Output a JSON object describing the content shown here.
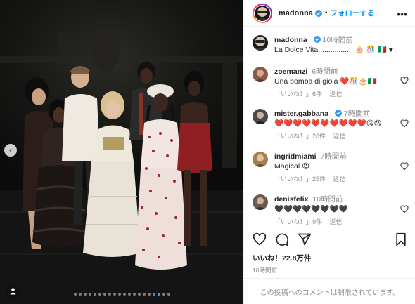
{
  "post": {
    "author": "madonna",
    "follow_label": "フォローする",
    "caption": {
      "username": "madonna",
      "time": "10時間前",
      "text": "La Dolce Vita.................",
      "emoji": "🎂 🎊 🇮🇹 ♥"
    },
    "likes_text": "いいね！22.8万件",
    "posted_time": "10時間前",
    "comments_closed": "この投稿へのコメントは制限されています。"
  },
  "comments": [
    {
      "username": "zoemanzi",
      "time": "6時間前",
      "text": "Una bomba di gioia ❤️🎊🎂🇮🇹",
      "likes": "「いいね！」6件",
      "reply": "返信",
      "avatar_color": "#8a5a4e"
    },
    {
      "username": "mister.gabbana",
      "time": "7時間前",
      "text": "❤️❤️❤️❤️❤️❤️❤️❤️❤️❤️😘😘",
      "likes": "「いいね！」28件",
      "reply": "返信",
      "avatar_color": "#4a4a4a"
    },
    {
      "username": "ingridmiami",
      "time": "7時間前",
      "text": "Magical 😍",
      "likes": "「いいね！」25件",
      "reply": "返信",
      "avatar_color": "#a7804f"
    },
    {
      "username": "denisfelix",
      "time": "10時間前",
      "text": "🖤🖤🖤🖤🖤🖤🖤🖤",
      "likes": "「いいね！」9件",
      "reply": "返信",
      "avatar_color": "#6b5a50"
    }
  ],
  "theme": {
    "follow_blue": "#0095f6",
    "muted": "#8e8e8e",
    "like_red": "#ed4956"
  },
  "icons": [
    "more-icon",
    "verified-icon",
    "heart-icon",
    "comment-icon",
    "share-icon",
    "bookmark-icon",
    "carousel-prev-icon",
    "user-tag-icon"
  ]
}
